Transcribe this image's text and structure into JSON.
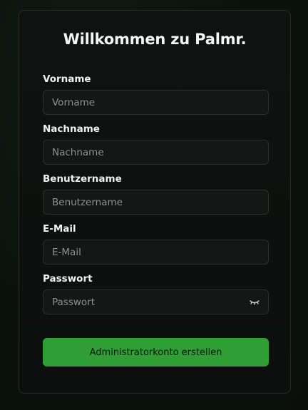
{
  "title": "Willkommen zu Palmr.",
  "fields": {
    "first_name": {
      "label": "Vorname",
      "placeholder": "Vorname",
      "value": ""
    },
    "last_name": {
      "label": "Nachname",
      "placeholder": "Nachname",
      "value": ""
    },
    "username": {
      "label": "Benutzername",
      "placeholder": "Benutzername",
      "value": ""
    },
    "email": {
      "label": "E-Mail",
      "placeholder": "E-Mail",
      "value": ""
    },
    "password": {
      "label": "Passwort",
      "placeholder": "Passwort",
      "value": "",
      "toggle_icon": "eye-closed-icon"
    }
  },
  "submit_label": "Administratorkonto erstellen",
  "colors": {
    "accent": "#2f9e34",
    "background": "#0b120d",
    "card": "#0f1210",
    "input_bg": "#141716",
    "border": "#2b302c"
  }
}
